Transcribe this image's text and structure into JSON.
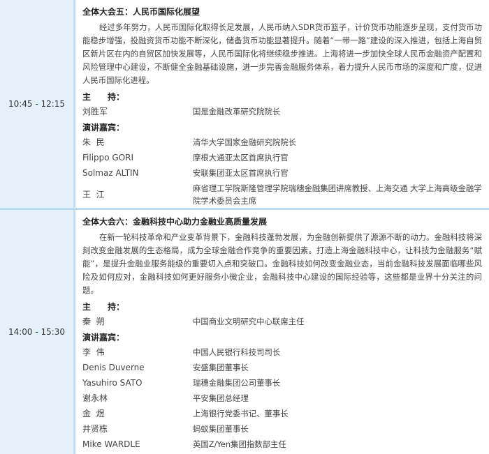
{
  "sessions": [
    {
      "time": "10:45 - 12:15",
      "title": "全体大会五：人民币国际化展望",
      "description": "经过多年努力，人民币国际化取得长足发展，人民币纳入SDR货币篮子，计价货币功能逐步呈现，支付货币功能稳步增强，投融资货币功能不断深化，储备货币功能显著提升。随着“一带一路”建设的深入推进，包括上海自贸区新片区在内的自贸区加快发展等，人民币国际化将继续稳步推进。上海将进一步加快全球人民币金融资产配置和风险管理中心建设，不断健全金融基础设施，进一步完善金融服务体系，着力提升人民币市场的深度和广度，促进人民币国际化进程。",
      "host_label": "主　　持：",
      "hosts": [
        {
          "name": "刘胜军",
          "role": "国是金融改革研究院院长"
        }
      ],
      "speaker_label": "演讲嘉宾：",
      "speakers": [
        {
          "name": "朱  民",
          "role": "清华大学国家金融研究院院长"
        },
        {
          "name": "Filippo GORI",
          "role": "摩根大通亚太区首席执行官"
        },
        {
          "name": "Solmaz ALTIN",
          "role": "安联集团亚太区首席执行官"
        },
        {
          "name": "王  江",
          "role": "麻省理工学院斯隆管理学院瑞穗金融集团讲席教授、上海交通 大学上海高级金融学院学术委员会主席"
        }
      ]
    },
    {
      "time": "14:00 - 15:30",
      "title": "全体大会六：金融科技中心助力金融业高质量发展",
      "description": "在新一轮科技革命和产业变革背景下，金融科技蓬勃发展，为金融创新提供了源源不断的动力。金融科技将深刻改变金融发展的生态格局，成为全球金融合作竞争的重要因素。打造上海金融科技中心，让科技为金融服务“赋能”，是提升金融业服务能级的重要切入点和突破口。金融科技如何改变金融业态，当前金融科技发展面临哪些风险及如何应对，金融科技如何更好服务小微企业，金融科技中心建设的国际经验等，这些都是业界十分关注的问题。",
      "host_label": "主　　持：",
      "hosts": [
        {
          "name": "秦  朔",
          "role": "中国商业文明研究中心联席主任"
        }
      ],
      "speaker_label": "演讲嘉宾：",
      "speakers": [
        {
          "name": "李  伟",
          "role": "中国人民银行科技司司长"
        },
        {
          "name": "Denis Duverne",
          "role": "安盛集团董事长"
        },
        {
          "name": "Yasuhiro SATO",
          "role": "瑞穗金融集团公司董事长"
        },
        {
          "name": "谢永林",
          "role": "平安集团总经理"
        },
        {
          "name": "金  煜",
          "role": "上海银行党委书记、董事长"
        },
        {
          "name": "井贤栋",
          "role": "蚂蚁集团董事长"
        },
        {
          "name": "Mike WARDLE",
          "role": "英国Z/Yen集团指数部主任"
        }
      ]
    }
  ]
}
